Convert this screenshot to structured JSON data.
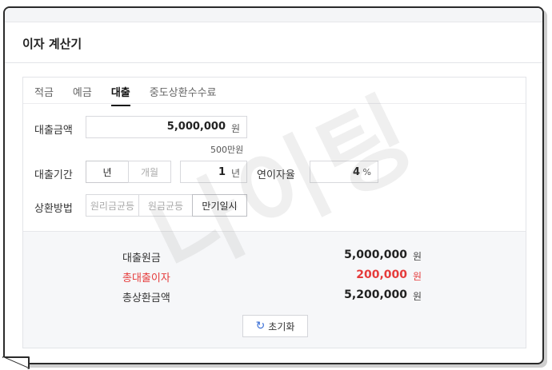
{
  "title": "이자 계산기",
  "tabs": [
    {
      "label": "적금",
      "active": false
    },
    {
      "label": "예금",
      "active": false
    },
    {
      "label": "대출",
      "active": true
    },
    {
      "label": "중도상환수수료",
      "active": false
    }
  ],
  "form": {
    "amount_label": "대출금액",
    "amount_value": "5,000,000",
    "amount_unit": "원",
    "amount_hint": "500만원",
    "period_label": "대출기간",
    "period_unit_options": [
      "년",
      "개월"
    ],
    "period_unit_selected": "년",
    "period_value": "1",
    "period_value_unit": "년",
    "rate_label": "연이자율",
    "rate_value": "4",
    "rate_unit": "%",
    "method_label": "상환방법",
    "method_options": [
      "원리금균등",
      "원금균등",
      "만기일시"
    ],
    "method_selected": "만기일시"
  },
  "results": {
    "principal_label": "대출원금",
    "principal_value": "5,000,000",
    "interest_label": "총대출이자",
    "interest_value": "200,000",
    "total_label": "총상환금액",
    "total_value": "5,200,000",
    "currency": "원"
  },
  "reset_label": "초기화",
  "watermark": "나이팅",
  "colors": {
    "accent_red": "#e53b3b",
    "reset_icon": "#3a6fd6"
  }
}
